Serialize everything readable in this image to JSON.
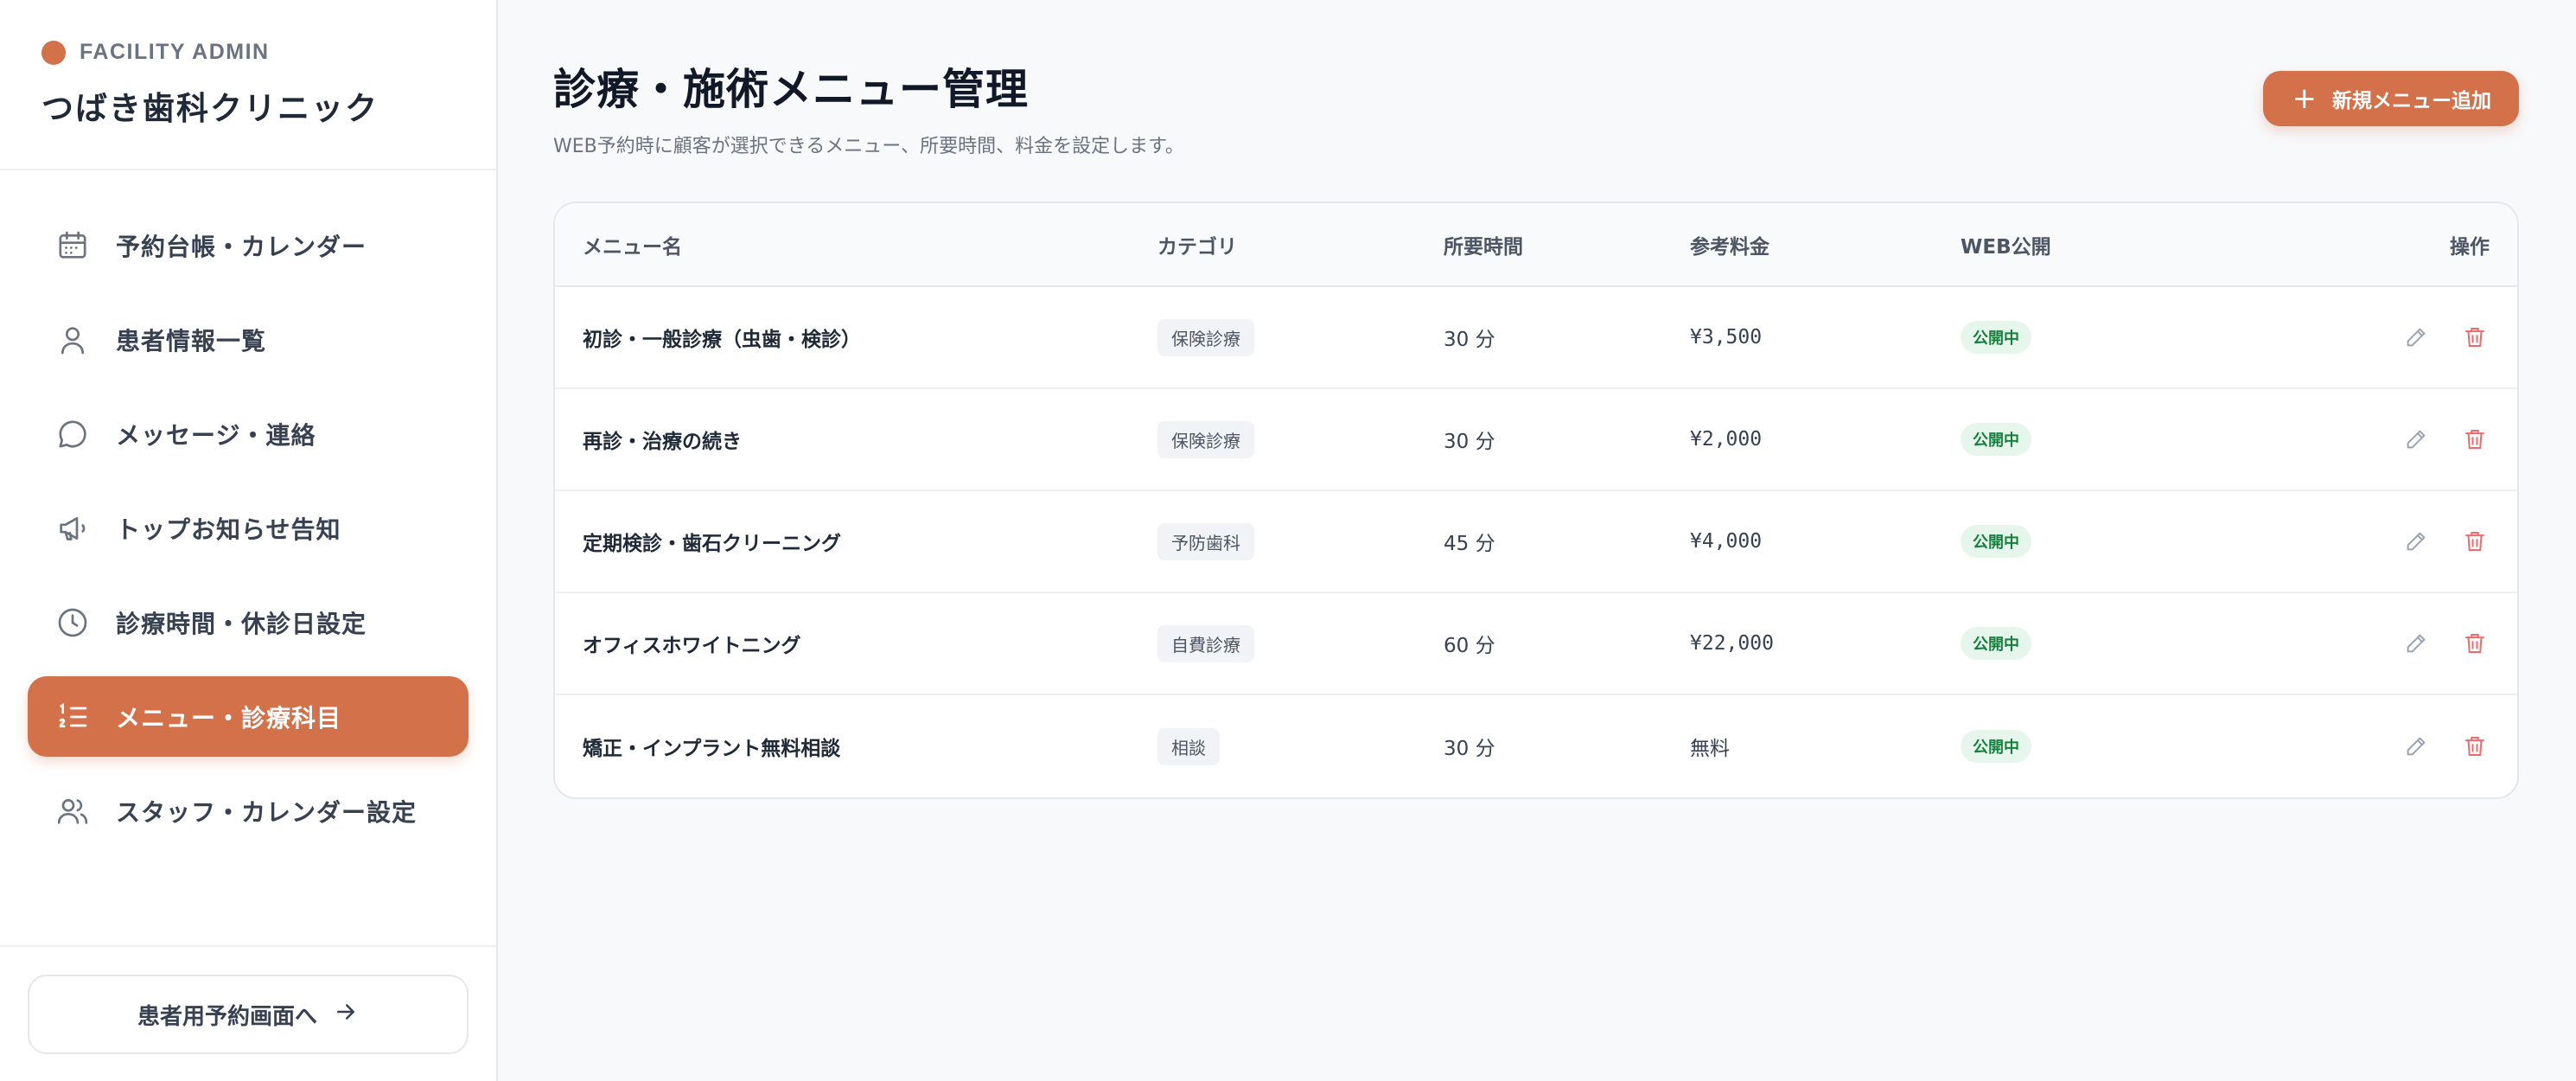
{
  "sidebar": {
    "facility_label": "FACILITY ADMIN",
    "clinic_name": "つばき歯科クリニック",
    "items": [
      {
        "label": "予約台帳・カレンダー",
        "icon": "calendar-icon"
      },
      {
        "label": "患者情報一覧",
        "icon": "user-icon"
      },
      {
        "label": "メッセージ・連絡",
        "icon": "message-icon"
      },
      {
        "label": "トップお知らせ告知",
        "icon": "megaphone-icon"
      },
      {
        "label": "診療時間・休診日設定",
        "icon": "clock-icon"
      },
      {
        "label": "メニュー・診療科目",
        "icon": "list-ordered-icon",
        "active": true
      },
      {
        "label": "スタッフ・カレンダー設定",
        "icon": "users-icon"
      }
    ],
    "patient_link_label": "患者用予約画面へ"
  },
  "header": {
    "title": "診療・施術メニュー管理",
    "subtitle": "WEB予約時に顧客が選択できるメニュー、所要時間、料金を設定します。",
    "add_button_label": "新規メニュー追加"
  },
  "table": {
    "columns": {
      "name": "メニュー名",
      "category": "カテゴリ",
      "duration": "所要時間",
      "fee": "参考料金",
      "web": "WEB公開",
      "actions": "操作"
    },
    "rows": [
      {
        "name": "初診・一般診療（虫歯・検診）",
        "category": "保険診療",
        "duration": "30 分",
        "fee": "¥3,500",
        "web": "公開中"
      },
      {
        "name": "再診・治療の続き",
        "category": "保険診療",
        "duration": "30 分",
        "fee": "¥2,000",
        "web": "公開中"
      },
      {
        "name": "定期検診・歯石クリーニング",
        "category": "予防歯科",
        "duration": "45 分",
        "fee": "¥4,000",
        "web": "公開中"
      },
      {
        "name": "オフィスホワイトニング",
        "category": "自費診療",
        "duration": "60 分",
        "fee": "¥22,000",
        "web": "公開中"
      },
      {
        "name": "矯正・インプラント無料相談",
        "category": "相談",
        "duration": "30 分",
        "fee": "無料",
        "web": "公開中"
      }
    ]
  },
  "colors": {
    "accent": "#d3714a",
    "published_text": "#15803d",
    "published_bg": "#e7f6ec",
    "delete": "#ef6b6b"
  }
}
